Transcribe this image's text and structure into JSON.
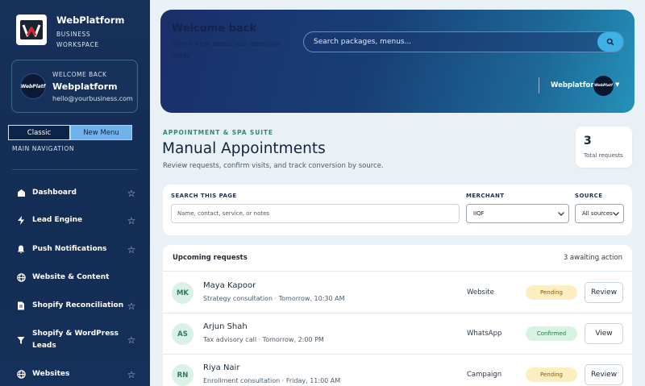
{
  "brand": {
    "name": "WebPlatform",
    "subtitle_line1": "BUSINESS",
    "subtitle_line2": "WORKSPACE",
    "logo_text": "W"
  },
  "welcome_card": {
    "label": "WELCOME BACK",
    "name": "Webplatform",
    "email": "hello@yourbusiness.com",
    "avatar_text": "WebPlatf"
  },
  "menu_toggle": {
    "classic": "Classic",
    "new_menu": "New Menu"
  },
  "nav": {
    "section_label": "MAIN NAVIGATION",
    "items": [
      {
        "label": "Dashboard",
        "icon": "dashboard-icon"
      },
      {
        "label": "Lead Engine",
        "icon": "lightning-icon"
      },
      {
        "label": "Push Notifications",
        "icon": "bell-icon"
      },
      {
        "label": "Website & Content",
        "icon": "globe-icon"
      },
      {
        "label": "Shopify Reconciliation",
        "icon": "document-icon"
      },
      {
        "label": "Shopify & WordPress Leads",
        "icon": "filter-icon"
      },
      {
        "label": "Websites",
        "icon": "globe-icon"
      }
    ]
  },
  "header": {
    "ghost_title": "Welcome back",
    "ghost_subtitle": "Here's what needs your attention today",
    "search_placeholder": "Search packages, menus...",
    "user_name": "Webplatform",
    "avatar_text": "WebPlatf"
  },
  "page": {
    "eyebrow": "APPOINTMENT & SPA SUITE",
    "title": "Manual Appointments",
    "subtitle": "Review requests, confirm visits, and track conversion by source."
  },
  "stats": {
    "total_value": "3",
    "total_label": "Total requests"
  },
  "filters": {
    "search_label": "SEARCH THIS PAGE",
    "search_placeholder": "Name, contact, service, or notes",
    "merchant_label": "MERCHANT",
    "merchant_value": "IIQF",
    "source_label": "SOURCE",
    "source_value": "All sources"
  },
  "requests": {
    "title": "Upcoming requests",
    "count_text": "3 awaiting action",
    "rows": [
      {
        "initials": "MK",
        "name": "Maya Kapoor",
        "detail": "Strategy consultation · Tomorrow, 10:30 AM",
        "source": "Website",
        "status": "Pending",
        "action": "Review"
      },
      {
        "initials": "AS",
        "name": "Arjun Shah",
        "detail": "Tax advisory call · Tomorrow, 2:00 PM",
        "source": "WhatsApp",
        "status": "Confirmed",
        "action": "View"
      },
      {
        "initials": "RN",
        "name": "Riya Nair",
        "detail": "Enrollment consultation · Friday, 11:00 AM",
        "source": "Campaign",
        "status": "Pending",
        "action": "Review"
      }
    ]
  },
  "colors": {
    "sidebar_bg": "#16305a",
    "accent_blue": "#3eb2e6",
    "eyebrow_green": "#2e8a78",
    "pending_bg": "#fbefc2",
    "confirmed_bg": "#d8f3e2"
  }
}
